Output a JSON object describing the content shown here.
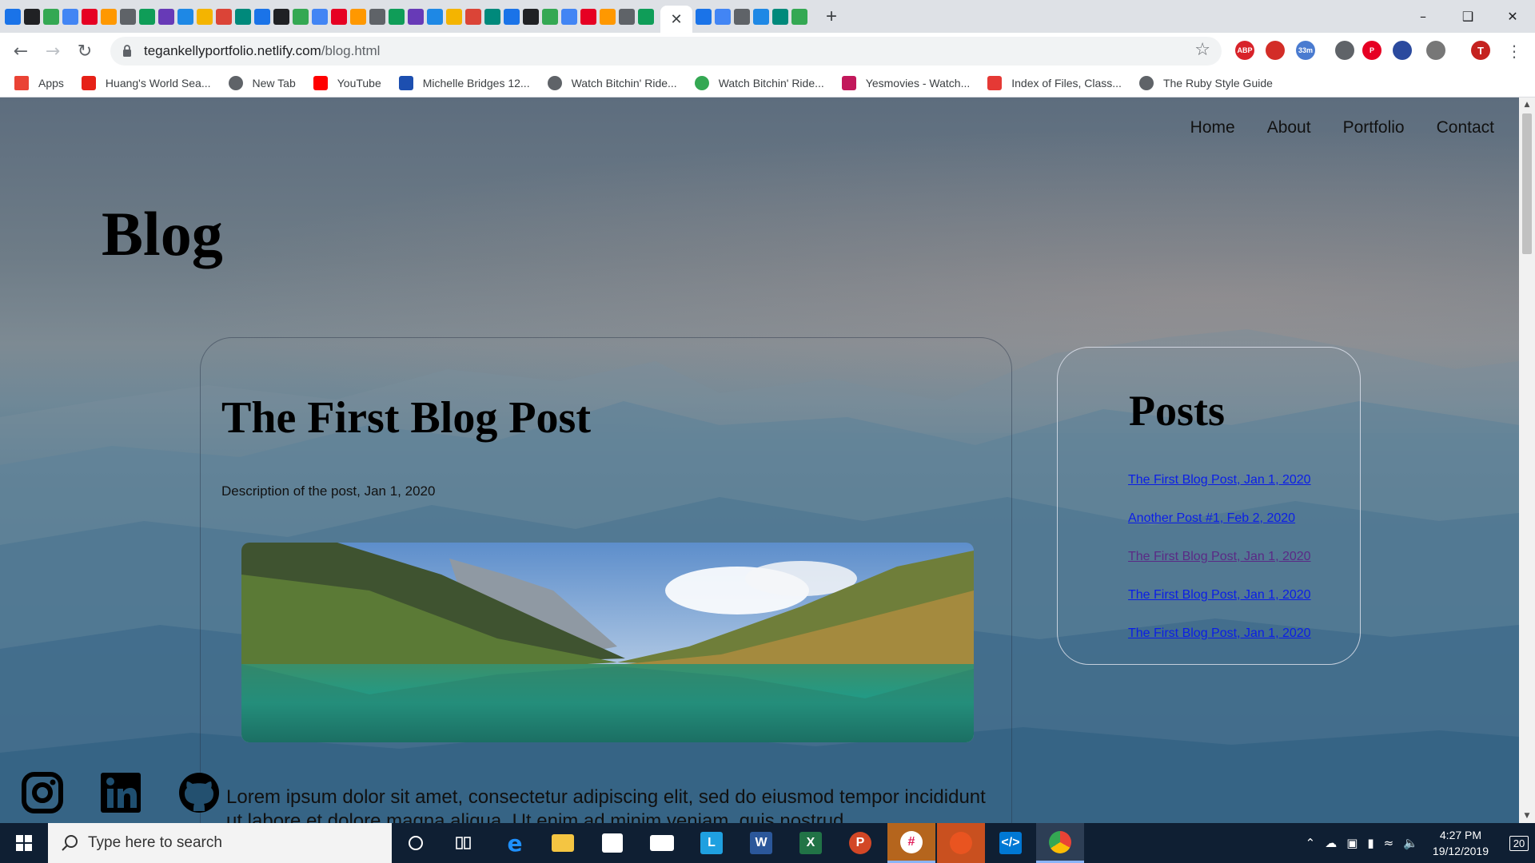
{
  "browser": {
    "url_host": "tegankellyportfolio.netlify.com",
    "url_path": "/blog.html",
    "extensions": [
      {
        "name": "abp-icon",
        "label": "ABP",
        "color": "#d8232a"
      },
      {
        "name": "lastpass-icon",
        "label": "",
        "color": "#d32d27"
      },
      {
        "name": "timer-icon",
        "label": "33m",
        "color": "#4a7bd0"
      },
      {
        "name": "pencil-icon",
        "label": "",
        "color": "#5f6368"
      },
      {
        "name": "pinterest-icon",
        "label": "P",
        "color": "#e60023"
      },
      {
        "name": "reader-icon",
        "label": "",
        "color": "#2b4a9e"
      },
      {
        "name": "pocket-icon",
        "label": "",
        "color": "#777777"
      }
    ],
    "profile_initial": "T"
  },
  "bookmarks": [
    {
      "label": "Apps",
      "color": "#ea4335"
    },
    {
      "label": "Huang's World Sea...",
      "color": "#e62117"
    },
    {
      "label": "New Tab",
      "color": "#5f6368"
    },
    {
      "label": "YouTube",
      "color": "#ff0000"
    },
    {
      "label": "Michelle Bridges 12...",
      "color": "#1d4fb0"
    },
    {
      "label": "Watch Bitchin' Ride...",
      "color": "#5f6368"
    },
    {
      "label": "Watch Bitchin' Ride...",
      "color": "#34a853"
    },
    {
      "label": "Yesmovies - Watch...",
      "color": "#c2185b"
    },
    {
      "label": "Index of Files, Class...",
      "color": "#e53935"
    },
    {
      "label": "The Ruby Style Guide",
      "color": "#5f6368"
    }
  ],
  "site": {
    "nav": [
      "Home",
      "About",
      "Portfolio",
      "Contact"
    ],
    "heading": "Blog",
    "post": {
      "title": "The First Blog Post",
      "description": "Description of the post, Jan 1, 2020",
      "body": "Lorem ipsum dolor sit amet, consectetur adipiscing elit, sed do eiusmod tempor incididunt ut labore et dolore magna aliqua. Ut enim ad minim veniam, quis nostrud"
    },
    "sidebar": {
      "heading": "Posts",
      "links": [
        {
          "label": "The First Blog Post, Jan 1, 2020",
          "visited": false
        },
        {
          "label": "Another Post #1, Feb 2, 2020",
          "visited": false
        },
        {
          "label": "The First Blog Post, Jan 1, 2020",
          "visited": true
        },
        {
          "label": "The First Blog Post, Jan 1, 2020",
          "visited": false
        },
        {
          "label": "The First Blog Post, Jan 1, 2020",
          "visited": false
        }
      ]
    },
    "social": [
      "instagram-icon",
      "linkedin-icon",
      "github-icon"
    ]
  },
  "taskbar": {
    "search_placeholder": "Type here to search",
    "time": "4:27 PM",
    "date": "19/12/2019",
    "notification_count": "20"
  }
}
